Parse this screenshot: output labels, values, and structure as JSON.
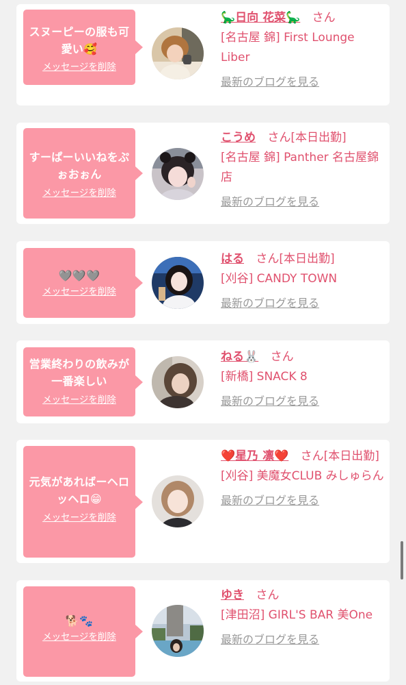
{
  "list": {
    "items": [
      {
        "bubble_message": "スヌーピーの服も可愛い🥰",
        "delete_label": "メッセージを削除",
        "name": "🦕日向 花菜🦕",
        "honorific": "さん",
        "status": "",
        "shop": "[名古屋 錦] First Lounge Liber",
        "blog_label": "最新のブログを見る"
      },
      {
        "bubble_message": "すーぱーいいねをぷぉおぉん",
        "delete_label": "メッセージを削除",
        "name": "こうめ",
        "honorific": "さん",
        "status": "[本日出勤]",
        "shop": "[名古屋 錦] Panther 名古屋錦店",
        "blog_label": "最新のブログを見る"
      },
      {
        "bubble_message": "🩶🩶🩶",
        "delete_label": "メッセージを削除",
        "name": "はる",
        "honorific": "さん",
        "status": "[本日出勤]",
        "shop": "[刈谷] CANDY TOWN",
        "blog_label": "最新のブログを見る"
      },
      {
        "bubble_message": "営業終わりの飲みが一番楽しい",
        "delete_label": "メッセージを削除",
        "name": "ねる🐰",
        "honorific": "さん",
        "status": "",
        "shop": "[新橋] SNACK 8",
        "blog_label": "最新のブログを見る"
      },
      {
        "bubble_message": "元気があればーヘロッヘロ😁",
        "delete_label": "メッセージを削除",
        "name": "❤️星乃 凛❤️",
        "honorific": "さん",
        "status": "[本日出勤]",
        "shop": "[刈谷] 美魔女CLUB みしゅらん",
        "blog_label": "最新のブログを見る"
      },
      {
        "bubble_message": "🐕🐾",
        "delete_label": "メッセージを削除",
        "name": "ゆき",
        "honorific": "さん",
        "status": "",
        "shop": "[津田沼] GIRL'S BAR 美One",
        "blog_label": "最新のブログを見る"
      }
    ]
  },
  "colors": {
    "accent": "#e0516e",
    "bubble": "#fb98a6",
    "page_bg": "#f1f1f1",
    "card_bg": "#ffffff",
    "link_gray": "#999999"
  }
}
